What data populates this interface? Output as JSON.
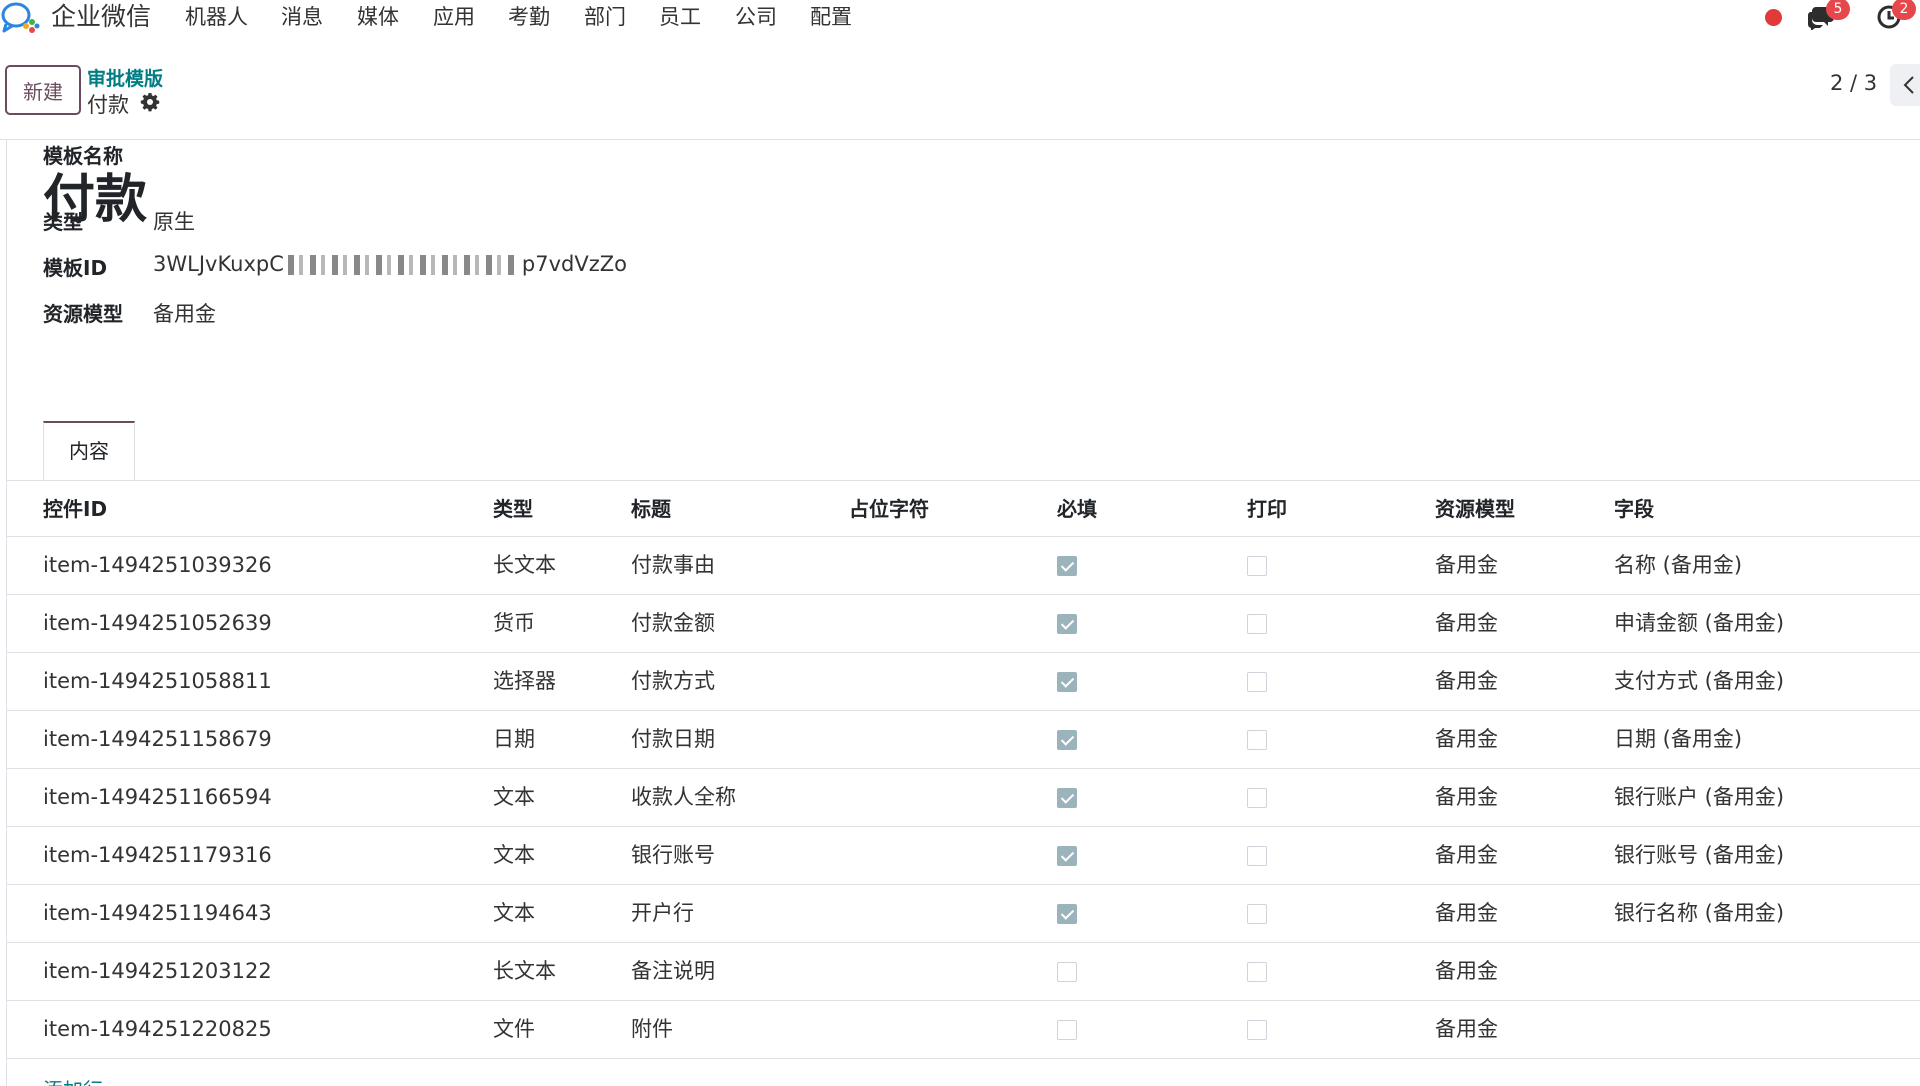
{
  "navbar": {
    "brand": "企业微信",
    "menu": [
      "机器人",
      "消息",
      "媒体",
      "应用",
      "考勤",
      "部门",
      "员工",
      "公司",
      "配置"
    ],
    "chat_count": "5",
    "activity_count": "2"
  },
  "control_panel": {
    "new_button": "新建",
    "breadcrumb_parent": "审批模版",
    "breadcrumb_current": "付款",
    "pager_value": "2 / 3"
  },
  "form": {
    "name_label": "模板名称",
    "name_value": "付款",
    "type_label": "类型",
    "type_value": "原生",
    "template_id_label": "模板ID",
    "template_id_prefix": "3WLJvKuxpC",
    "template_id_suffix": "p7vdVzZo",
    "resource_model_label": "资源模型",
    "resource_model_value": "备用金"
  },
  "tabs": [
    {
      "label": "内容",
      "active": true
    }
  ],
  "table": {
    "columns": [
      "控件ID",
      "类型",
      "标题",
      "占位字符",
      "必填",
      "打印",
      "资源模型",
      "字段"
    ],
    "rows": [
      {
        "id": "item-1494251039326",
        "type": "长文本",
        "title": "付款事由",
        "placeholder": "",
        "required": true,
        "print": false,
        "model": "备用金",
        "field": "名称 (备用金)"
      },
      {
        "id": "item-1494251052639",
        "type": "货币",
        "title": "付款金额",
        "placeholder": "",
        "required": true,
        "print": false,
        "model": "备用金",
        "field": "申请金额 (备用金)"
      },
      {
        "id": "item-1494251058811",
        "type": "选择器",
        "title": "付款方式",
        "placeholder": "",
        "required": true,
        "print": false,
        "model": "备用金",
        "field": "支付方式 (备用金)"
      },
      {
        "id": "item-1494251158679",
        "type": "日期",
        "title": "付款日期",
        "placeholder": "",
        "required": true,
        "print": false,
        "model": "备用金",
        "field": "日期 (备用金)"
      },
      {
        "id": "item-1494251166594",
        "type": "文本",
        "title": "收款人全称",
        "placeholder": "",
        "required": true,
        "print": false,
        "model": "备用金",
        "field": "银行账户 (备用金)"
      },
      {
        "id": "item-1494251179316",
        "type": "文本",
        "title": "银行账号",
        "placeholder": "",
        "required": true,
        "print": false,
        "model": "备用金",
        "field": "银行账号 (备用金)"
      },
      {
        "id": "item-1494251194643",
        "type": "文本",
        "title": "开户行",
        "placeholder": "",
        "required": true,
        "print": false,
        "model": "备用金",
        "field": "银行名称 (备用金)"
      },
      {
        "id": "item-1494251203122",
        "type": "长文本",
        "title": "备注说明",
        "placeholder": "",
        "required": false,
        "print": false,
        "model": "备用金",
        "field": ""
      },
      {
        "id": "item-1494251220825",
        "type": "文件",
        "title": "附件",
        "placeholder": "",
        "required": false,
        "print": false,
        "model": "备用金",
        "field": ""
      }
    ],
    "add_line": "添加行"
  },
  "colors": {
    "accent": "#6b4c5f",
    "link": "#017e84",
    "checkbox_checked": "#9bb3bb",
    "notification_dot": "#e03a3a"
  },
  "icons": [
    "wecom-logo-icon",
    "gear-icon",
    "chat-icon",
    "clock-icon",
    "chevron-left-icon"
  ]
}
